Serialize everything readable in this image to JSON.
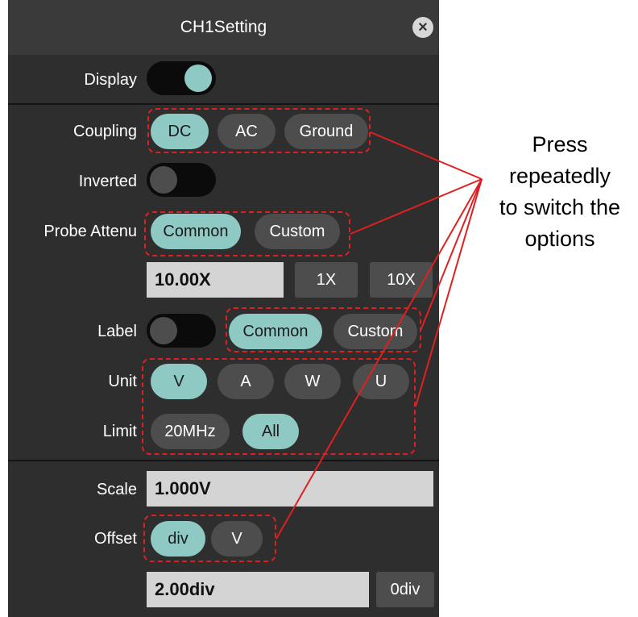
{
  "window": {
    "title": "CH1Setting",
    "close_icon": "close-icon"
  },
  "display": {
    "label": "Display",
    "on": true
  },
  "coupling": {
    "label": "Coupling",
    "options": [
      "DC",
      "AC",
      "Ground"
    ],
    "selected": "DC"
  },
  "inverted": {
    "label": "Inverted",
    "on": false
  },
  "probe": {
    "label": "Probe Attenu",
    "options": [
      "Common",
      "Custom"
    ],
    "selected": "Common",
    "value": "10.00X",
    "presets": [
      "1X",
      "10X"
    ]
  },
  "label_row": {
    "label": "Label",
    "on": false,
    "options": [
      "Common",
      "Custom"
    ],
    "selected": "Common"
  },
  "unit": {
    "label": "Unit",
    "options": [
      "V",
      "A",
      "W",
      "U"
    ],
    "selected": "V"
  },
  "limit": {
    "label": "Limit",
    "options": [
      "20MHz",
      "All"
    ],
    "selected": "All"
  },
  "scale": {
    "label": "Scale",
    "value": "1.000V"
  },
  "offset": {
    "label": "Offset",
    "options": [
      "div",
      "V"
    ],
    "selected": "div",
    "value": "2.00div",
    "reset": "0div"
  },
  "annotation": {
    "lines": [
      "Press",
      "repeatedly",
      "to switch the",
      "options"
    ],
    "color": "#e02020"
  },
  "colors": {
    "panel": "#2e2e2e",
    "selected": "#8fc9c4",
    "unselected": "#4d4d4d",
    "toggle_on_knob": "#8fc9c4"
  }
}
